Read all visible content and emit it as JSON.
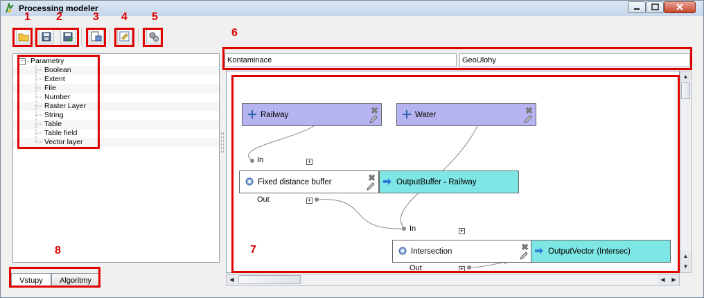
{
  "window": {
    "title": "Processing modeler"
  },
  "toolbar": {
    "buttons": [
      {
        "name": "open-model"
      },
      {
        "name": "save-model"
      },
      {
        "name": "save-as-model"
      },
      {
        "name": "export-image"
      },
      {
        "name": "edit-help"
      },
      {
        "name": "run-model"
      }
    ]
  },
  "callouts": [
    "1",
    "2",
    "3",
    "4",
    "5",
    "6",
    "7",
    "8"
  ],
  "inputs_tree": {
    "root": "Parametry",
    "items": [
      "Boolean",
      "Extent",
      "File",
      "Number",
      "Raster Layer",
      "String",
      "Table",
      "Table field",
      "Vector layer"
    ]
  },
  "tabs": {
    "inputs": "Vstupy",
    "algorithms": "Algoritmy"
  },
  "model": {
    "name": "Kontaminace",
    "group": "GeoUlohy"
  },
  "canvas": {
    "in_label": "In",
    "out_label": "Out",
    "inputs": [
      {
        "label": "Railway"
      },
      {
        "label": "Water"
      }
    ],
    "algorithms": [
      {
        "label": "Fixed distance buffer",
        "output": "OutputBuffer - Railway"
      },
      {
        "label": "Intersection",
        "output": "OutputVector (Intersec)"
      }
    ]
  },
  "colors": {
    "input_node": "#b6b4f0",
    "output_node": "#7fe6e6",
    "highlight": "#e00000"
  }
}
